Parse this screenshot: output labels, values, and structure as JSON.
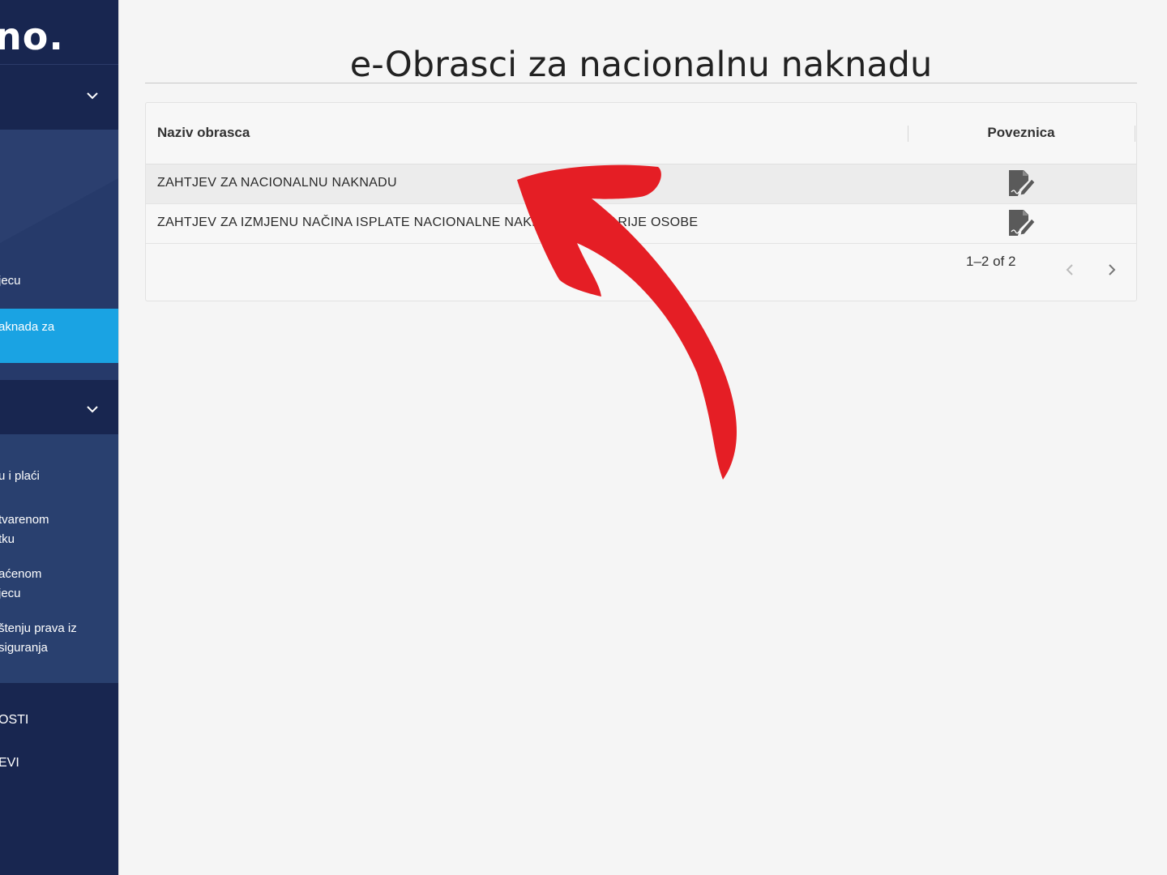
{
  "sidebar": {
    "logo": "no.",
    "items": [
      {
        "label": "jecu"
      },
      {
        "label": "aknada za"
      },
      {
        "label": "u i plaći"
      },
      {
        "label": "tvarenom"
      },
      {
        "label": "tku"
      },
      {
        "label": "aćenom"
      },
      {
        "label": "jecu"
      },
      {
        "label": "štenju prava iz"
      },
      {
        "label": "siguranja"
      }
    ],
    "bottom": [
      {
        "label": "OSTI"
      },
      {
        "label": "EVI"
      }
    ]
  },
  "main": {
    "title": "e-Obrasci za nacionalnu naknadu",
    "table": {
      "columns": [
        "Naziv obrasca",
        "Poveznica"
      ],
      "rows": [
        {
          "name": "ZAHTJEV ZA NACIONALNU NAKNADU",
          "icon": "edit-document-icon"
        },
        {
          "name": "ZAHTJEV ZA IZMJENU NAČINA ISPLATE NACIONALNE NAKNADE ZA STARIJE OSOBE",
          "icon": "edit-document-icon"
        }
      ],
      "pagination": "1–2 of 2"
    }
  },
  "colors": {
    "sidebar_bg": "#182650",
    "sidebar_panel": "#263a6a",
    "active_item": "#1aa3e3",
    "arrow": "#e51e25"
  }
}
